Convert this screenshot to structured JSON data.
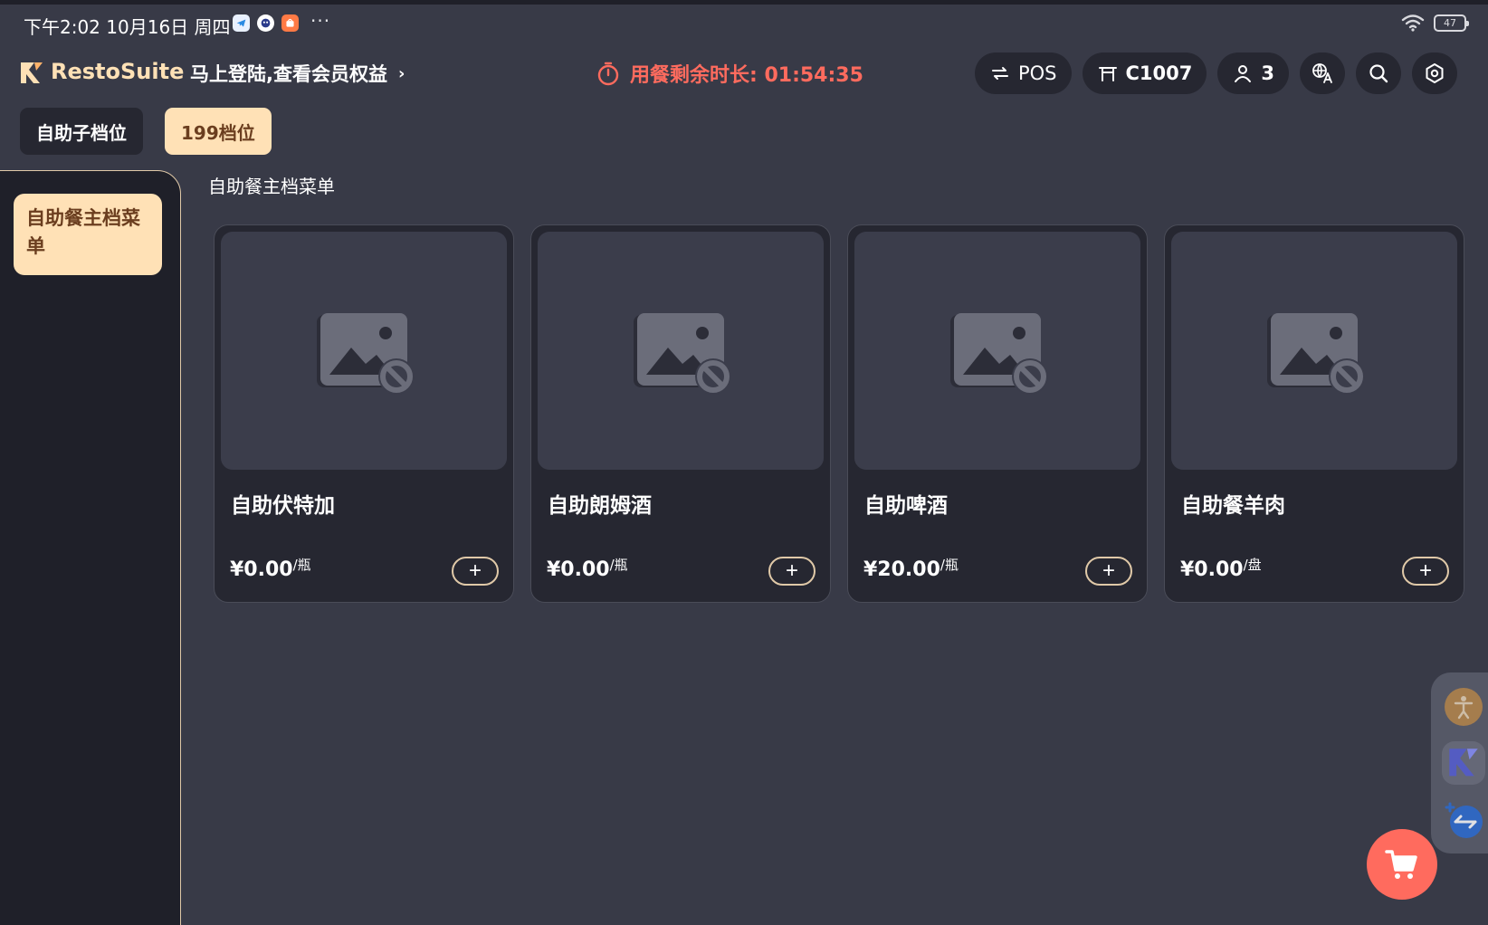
{
  "status_bar": {
    "time_date": "下午2:02 10月16日 周四",
    "more": "···",
    "battery": "47"
  },
  "header": {
    "brand": "RestoSuite",
    "login_prompt": "马上登陆,查看会员权益",
    "login_chevron": "›",
    "timer_text": "用餐剩余时长: 01:54:35",
    "pos_label": "POS",
    "table_label": "C1007",
    "guests": "3"
  },
  "tabs": [
    {
      "label": "自助子档位",
      "active": false
    },
    {
      "label": "199档位",
      "active": true
    }
  ],
  "sidebar": {
    "items": [
      {
        "label": "自助餐主档菜单",
        "active": true
      }
    ]
  },
  "section": {
    "title": "自助餐主档菜单"
  },
  "products": [
    {
      "name": "自助伏特加",
      "price": "¥0.00",
      "unit": "/瓶"
    },
    {
      "name": "自助朗姆酒",
      "price": "¥0.00",
      "unit": "/瓶"
    },
    {
      "name": "自助啤酒",
      "price": "¥20.00",
      "unit": "/瓶"
    },
    {
      "name": "自助餐羊肉",
      "price": "¥0.00",
      "unit": "/盘"
    }
  ],
  "add_label": "+",
  "colors": {
    "background": "#383a47",
    "panel": "#262731",
    "accent": "#ffe1b6",
    "accent_text": "#6b3e1f",
    "timer": "#ff6b5e",
    "cart": "#ff6b5e"
  },
  "icons": {
    "pos": "swap-icon",
    "table": "table-icon",
    "guests": "person-icon",
    "language": "translate-icon",
    "search": "search-icon",
    "settings": "settings-icon",
    "cart": "cart-icon",
    "placeholder": "image-unavailable-icon"
  }
}
